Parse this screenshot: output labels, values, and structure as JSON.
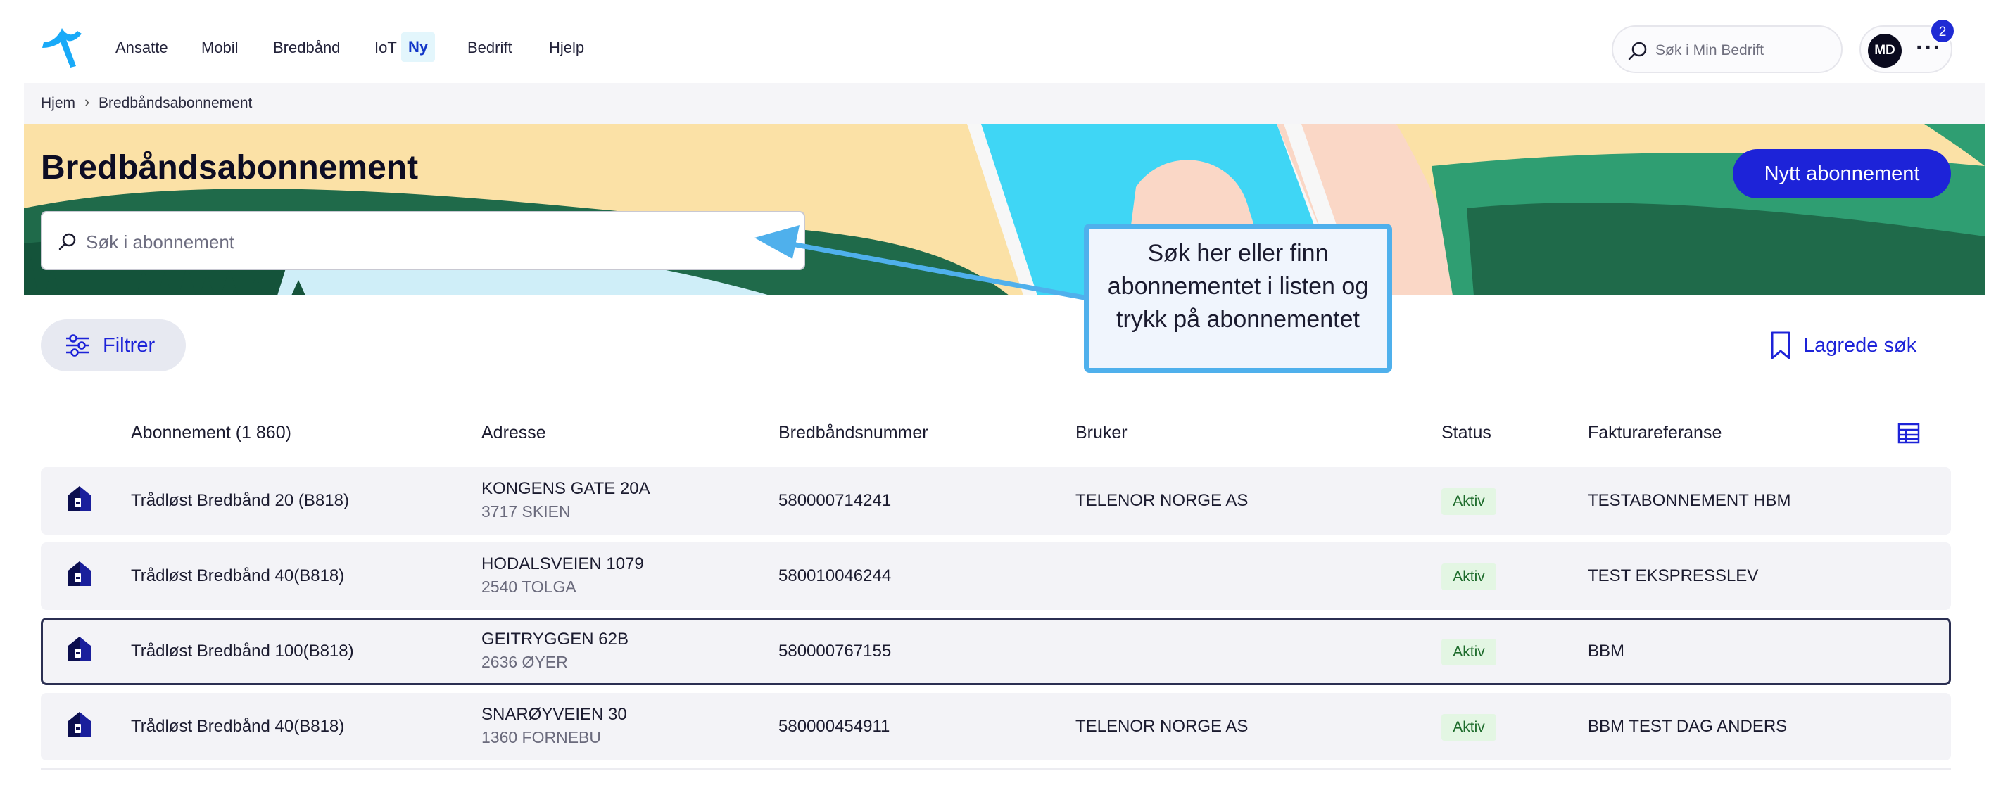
{
  "nav": {
    "items": [
      "Ansatte",
      "Mobil",
      "Bredbånd",
      "IoT",
      "Bedrift",
      "Hjelp"
    ],
    "iot_badge": "Ny",
    "search_placeholder": "Søk i Min Bedrift",
    "avatar_initials": "MD",
    "more_label": "···",
    "notification_count": "2"
  },
  "breadcrumb": {
    "home": "Hjem",
    "separator": "›",
    "current": "Bredbåndsabonnement"
  },
  "page": {
    "title": "Bredbåndsabonnement",
    "new_button": "Nytt abonnement",
    "search_placeholder": "Søk i abonnement"
  },
  "callout": {
    "text": "Søk her eller finn abonnementet i listen og trykk på abonnementet"
  },
  "toolbar": {
    "filter_label": "Filtrer",
    "saved_label": "Lagrede søk"
  },
  "table": {
    "columns": [
      "Abonnement (1 860)",
      "Adresse",
      "Bredbåndsnummer",
      "Bruker",
      "Status",
      "Fakturareferanse"
    ],
    "rows": [
      {
        "subscription": "Trådløst Bredbånd 20 (B818)",
        "street": "KONGENS GATE 20A",
        "city": "3717 SKIEN",
        "number": "580000714241",
        "user": "TELENOR NORGE AS",
        "status": "Aktiv",
        "invoice_ref": "TESTABONNEMENT HBM",
        "selected": false
      },
      {
        "subscription": "Trådløst Bredbånd 40(B818)",
        "street": "HODALSVEIEN 1079",
        "city": "2540 TOLGA",
        "number": "580010046244",
        "user": "",
        "status": "Aktiv",
        "invoice_ref": "TEST EKSPRESSLEV",
        "selected": false
      },
      {
        "subscription": "Trådløst Bredbånd 100(B818)",
        "street": "GEITRYGGEN 62B",
        "city": "2636 ØYER",
        "number": "580000767155",
        "user": "",
        "status": "Aktiv",
        "invoice_ref": "BBM",
        "selected": true
      },
      {
        "subscription": "Trådløst Bredbånd 40(B818)",
        "street": "SNARØYVEIEN 30",
        "city": "1360 FORNEBU",
        "number": "580000454911",
        "user": "TELENOR NORGE AS",
        "status": "Aktiv",
        "invoice_ref": "BBM TEST DAG ANDERS",
        "selected": false
      }
    ]
  },
  "colors": {
    "brand_blue": "#1d23d8",
    "callout_border": "#4fb0ec",
    "status_bg": "#e3f6e3",
    "status_text": "#1d6b2b"
  },
  "icons": {
    "logo": "telenor-logo",
    "search": "search-icon",
    "filter": "sliders-icon",
    "saved": "bookmark-icon",
    "columns": "table-columns-icon",
    "row": "house-router-icon"
  }
}
